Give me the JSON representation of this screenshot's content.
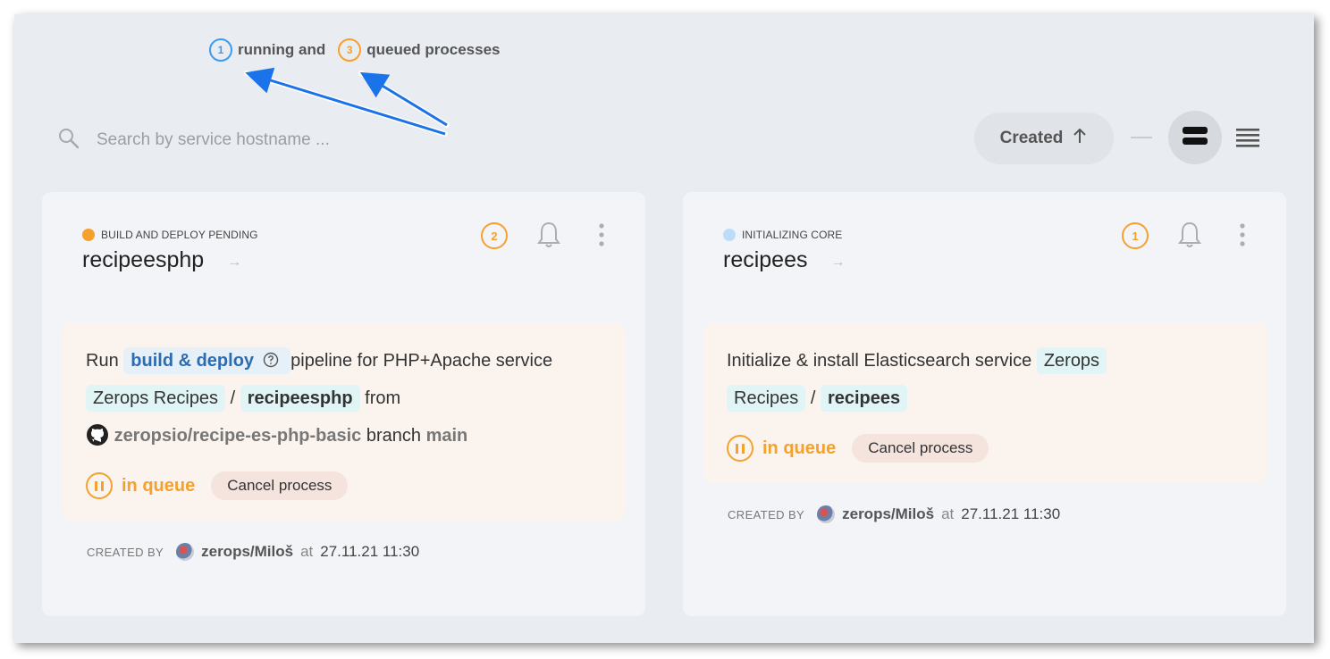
{
  "summary": {
    "running_count": "1",
    "running_text": "running and",
    "queued_count": "3",
    "queued_text": "queued processes"
  },
  "search": {
    "placeholder": "Search by service hostname ..."
  },
  "toolbar": {
    "sort_label": "Created",
    "sort_icon": "arrow-up-icon"
  },
  "colors": {
    "running": "#3c9bf0",
    "queued": "#f5a12b",
    "link": "#2d6cb0"
  },
  "cards": [
    {
      "status": "BUILD AND DEPLOY PENDING",
      "status_color": "#f5a12b",
      "title": "recipeesphp",
      "process_count": "2",
      "process": {
        "run_prefix": "Run",
        "pipeline_chip": "build & deploy",
        "pipeline_suffix": "pipeline for PHP+Apache service",
        "project_chip": "Zerops Recipes",
        "separator": "/",
        "service_chip": "recipeesphp",
        "from_text": "from",
        "repo": "zeropsio/recipe-es-php-basic",
        "branch_text": "branch",
        "branch": "main",
        "queue_label": "in queue",
        "cancel_label": "Cancel process"
      },
      "created": {
        "label": "CREATED BY",
        "user": "zerops/Miloš",
        "at": "at",
        "datetime": "27.11.21 11:30"
      }
    },
    {
      "status": "INITIALIZING CORE",
      "status_color": "#bcdcf7",
      "title": "recipees",
      "process_count": "1",
      "process": {
        "text_prefix": "Initialize & install Elasticsearch service",
        "project_chip_1": "Zerops",
        "project_chip_2": "Recipes",
        "separator": "/",
        "service_chip": "recipees",
        "queue_label": "in queue",
        "cancel_label": "Cancel process"
      },
      "created": {
        "label": "CREATED BY",
        "user": "zerops/Miloš",
        "at": "at",
        "datetime": "27.11.21 11:30"
      }
    }
  ]
}
